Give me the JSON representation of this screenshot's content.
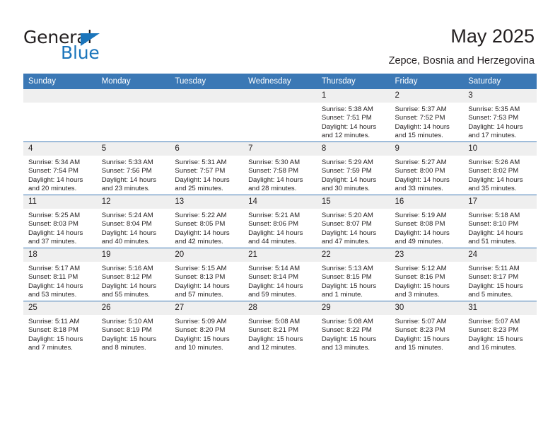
{
  "brand": {
    "name_top": "General",
    "name_bottom": "Blue",
    "accent_color": "#1b75bb"
  },
  "header": {
    "title": "May 2025",
    "subtitle": "Zepce, Bosnia and Herzegovina"
  },
  "theme": {
    "header_row_color": "#3b78b5",
    "daynum_band_color": "#efefef",
    "text_color": "#231f20"
  },
  "weekdays": [
    "Sunday",
    "Monday",
    "Tuesday",
    "Wednesday",
    "Thursday",
    "Friday",
    "Saturday"
  ],
  "labels": {
    "sunrise_prefix": "Sunrise:",
    "sunset_prefix": "Sunset:",
    "daylight_prefix": "Daylight:"
  },
  "weeks": [
    [
      {
        "day": "",
        "empty": true
      },
      {
        "day": "",
        "empty": true
      },
      {
        "day": "",
        "empty": true
      },
      {
        "day": "",
        "empty": true
      },
      {
        "day": "1",
        "sunrise": "Sunrise: 5:38 AM",
        "sunset": "Sunset: 7:51 PM",
        "daylight": "Daylight: 14 hours and 12 minutes."
      },
      {
        "day": "2",
        "sunrise": "Sunrise: 5:37 AM",
        "sunset": "Sunset: 7:52 PM",
        "daylight": "Daylight: 14 hours and 15 minutes."
      },
      {
        "day": "3",
        "sunrise": "Sunrise: 5:35 AM",
        "sunset": "Sunset: 7:53 PM",
        "daylight": "Daylight: 14 hours and 17 minutes."
      }
    ],
    [
      {
        "day": "4",
        "sunrise": "Sunrise: 5:34 AM",
        "sunset": "Sunset: 7:54 PM",
        "daylight": "Daylight: 14 hours and 20 minutes."
      },
      {
        "day": "5",
        "sunrise": "Sunrise: 5:33 AM",
        "sunset": "Sunset: 7:56 PM",
        "daylight": "Daylight: 14 hours and 23 minutes."
      },
      {
        "day": "6",
        "sunrise": "Sunrise: 5:31 AM",
        "sunset": "Sunset: 7:57 PM",
        "daylight": "Daylight: 14 hours and 25 minutes."
      },
      {
        "day": "7",
        "sunrise": "Sunrise: 5:30 AM",
        "sunset": "Sunset: 7:58 PM",
        "daylight": "Daylight: 14 hours and 28 minutes."
      },
      {
        "day": "8",
        "sunrise": "Sunrise: 5:29 AM",
        "sunset": "Sunset: 7:59 PM",
        "daylight": "Daylight: 14 hours and 30 minutes."
      },
      {
        "day": "9",
        "sunrise": "Sunrise: 5:27 AM",
        "sunset": "Sunset: 8:00 PM",
        "daylight": "Daylight: 14 hours and 33 minutes."
      },
      {
        "day": "10",
        "sunrise": "Sunrise: 5:26 AM",
        "sunset": "Sunset: 8:02 PM",
        "daylight": "Daylight: 14 hours and 35 minutes."
      }
    ],
    [
      {
        "day": "11",
        "sunrise": "Sunrise: 5:25 AM",
        "sunset": "Sunset: 8:03 PM",
        "daylight": "Daylight: 14 hours and 37 minutes."
      },
      {
        "day": "12",
        "sunrise": "Sunrise: 5:24 AM",
        "sunset": "Sunset: 8:04 PM",
        "daylight": "Daylight: 14 hours and 40 minutes."
      },
      {
        "day": "13",
        "sunrise": "Sunrise: 5:22 AM",
        "sunset": "Sunset: 8:05 PM",
        "daylight": "Daylight: 14 hours and 42 minutes."
      },
      {
        "day": "14",
        "sunrise": "Sunrise: 5:21 AM",
        "sunset": "Sunset: 8:06 PM",
        "daylight": "Daylight: 14 hours and 44 minutes."
      },
      {
        "day": "15",
        "sunrise": "Sunrise: 5:20 AM",
        "sunset": "Sunset: 8:07 PM",
        "daylight": "Daylight: 14 hours and 47 minutes."
      },
      {
        "day": "16",
        "sunrise": "Sunrise: 5:19 AM",
        "sunset": "Sunset: 8:08 PM",
        "daylight": "Daylight: 14 hours and 49 minutes."
      },
      {
        "day": "17",
        "sunrise": "Sunrise: 5:18 AM",
        "sunset": "Sunset: 8:10 PM",
        "daylight": "Daylight: 14 hours and 51 minutes."
      }
    ],
    [
      {
        "day": "18",
        "sunrise": "Sunrise: 5:17 AM",
        "sunset": "Sunset: 8:11 PM",
        "daylight": "Daylight: 14 hours and 53 minutes."
      },
      {
        "day": "19",
        "sunrise": "Sunrise: 5:16 AM",
        "sunset": "Sunset: 8:12 PM",
        "daylight": "Daylight: 14 hours and 55 minutes."
      },
      {
        "day": "20",
        "sunrise": "Sunrise: 5:15 AM",
        "sunset": "Sunset: 8:13 PM",
        "daylight": "Daylight: 14 hours and 57 minutes."
      },
      {
        "day": "21",
        "sunrise": "Sunrise: 5:14 AM",
        "sunset": "Sunset: 8:14 PM",
        "daylight": "Daylight: 14 hours and 59 minutes."
      },
      {
        "day": "22",
        "sunrise": "Sunrise: 5:13 AM",
        "sunset": "Sunset: 8:15 PM",
        "daylight": "Daylight: 15 hours and 1 minute."
      },
      {
        "day": "23",
        "sunrise": "Sunrise: 5:12 AM",
        "sunset": "Sunset: 8:16 PM",
        "daylight": "Daylight: 15 hours and 3 minutes."
      },
      {
        "day": "24",
        "sunrise": "Sunrise: 5:11 AM",
        "sunset": "Sunset: 8:17 PM",
        "daylight": "Daylight: 15 hours and 5 minutes."
      }
    ],
    [
      {
        "day": "25",
        "sunrise": "Sunrise: 5:11 AM",
        "sunset": "Sunset: 8:18 PM",
        "daylight": "Daylight: 15 hours and 7 minutes."
      },
      {
        "day": "26",
        "sunrise": "Sunrise: 5:10 AM",
        "sunset": "Sunset: 8:19 PM",
        "daylight": "Daylight: 15 hours and 8 minutes."
      },
      {
        "day": "27",
        "sunrise": "Sunrise: 5:09 AM",
        "sunset": "Sunset: 8:20 PM",
        "daylight": "Daylight: 15 hours and 10 minutes."
      },
      {
        "day": "28",
        "sunrise": "Sunrise: 5:08 AM",
        "sunset": "Sunset: 8:21 PM",
        "daylight": "Daylight: 15 hours and 12 minutes."
      },
      {
        "day": "29",
        "sunrise": "Sunrise: 5:08 AM",
        "sunset": "Sunset: 8:22 PM",
        "daylight": "Daylight: 15 hours and 13 minutes."
      },
      {
        "day": "30",
        "sunrise": "Sunrise: 5:07 AM",
        "sunset": "Sunset: 8:23 PM",
        "daylight": "Daylight: 15 hours and 15 minutes."
      },
      {
        "day": "31",
        "sunrise": "Sunrise: 5:07 AM",
        "sunset": "Sunset: 8:23 PM",
        "daylight": "Daylight: 15 hours and 16 minutes."
      }
    ]
  ]
}
